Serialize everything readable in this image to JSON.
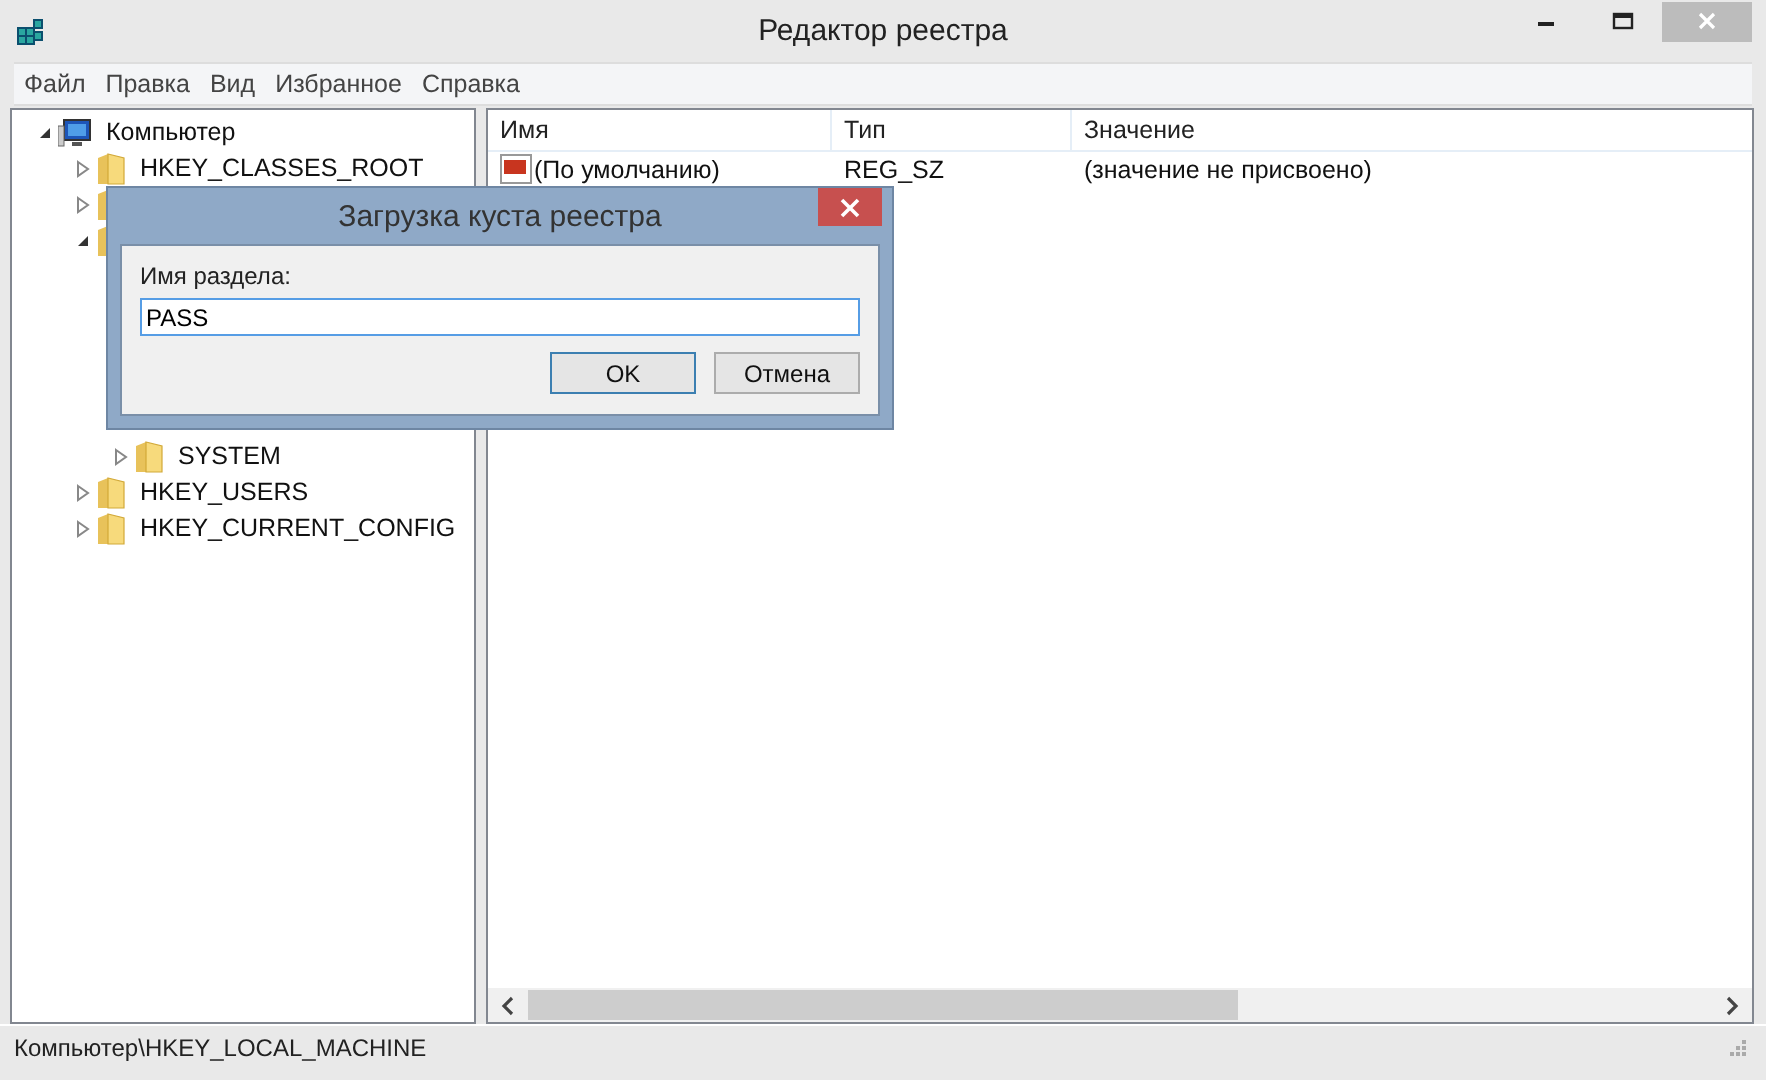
{
  "window": {
    "title": "Редактор реестра"
  },
  "menu": [
    "Файл",
    "Правка",
    "Вид",
    "Избранное",
    "Справка"
  ],
  "tree": {
    "label": "Компьютер",
    "expanded": true,
    "children": [
      {
        "label": "HKEY_CLASSES_ROOT",
        "expanded": false
      },
      {
        "expanded": false
      },
      {
        "expanded": true,
        "children": [
          {
            "kind": "covered"
          },
          {
            "kind": "covered"
          },
          {
            "kind": "covered"
          },
          {
            "kind": "covered"
          },
          {
            "kind": "covered"
          },
          {
            "label": "SYSTEM",
            "expanded": false
          }
        ]
      },
      {
        "label": "HKEY_USERS",
        "expanded": false
      },
      {
        "label": "HKEY_CURRENT_CONFIG",
        "expanded": false
      }
    ]
  },
  "table": {
    "columns": [
      "Имя",
      "Тип",
      "Значение"
    ],
    "rows": [
      {
        "name": "(По умолчанию)",
        "type": "REG_SZ",
        "value": "(значение не присвоено)"
      }
    ]
  },
  "status_bar": "Компьютер\\HKEY_LOCAL_MACHINE",
  "dialog": {
    "title": "Загрузка куста реестра",
    "label": "Имя раздела:",
    "value": "PASS",
    "buttons": [
      {
        "label": "OK",
        "default": true
      },
      {
        "label": "Отмена",
        "default": false
      }
    ]
  }
}
